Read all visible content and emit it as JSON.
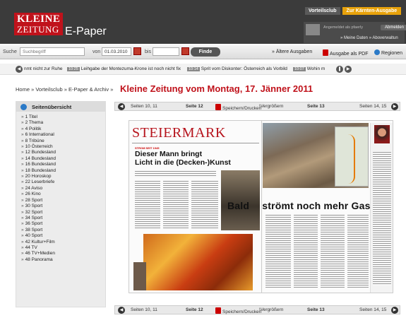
{
  "header": {
    "logo_top": "KLEINE",
    "logo_bottom": "ZEITUNG",
    "product": "E-Paper",
    "tab_club": "Vorteilsclub",
    "tab_region": "Zur Kärnten-Ausgabe",
    "login_status": "Angemeldet als pfaerly",
    "logout": "Abmelden",
    "user_links": "» Meine Daten » Aboverwaltun"
  },
  "search": {
    "label": "Suche",
    "placeholder": "Suchbegriff",
    "from_label": "von",
    "from_value": "01.03.2010",
    "to_label": "bis",
    "find": "Finde",
    "older": "» Ältere Ausgaben",
    "pdf": "Ausgabe als PDF",
    "regions": "Regionen"
  },
  "ticker": {
    "items": [
      {
        "time": "",
        "text": "nmt nicht zur Ruhe"
      },
      {
        "time": "10:25",
        "text": "Leihgabe der Montezuma-Krone ist noch nicht fix"
      },
      {
        "time": "10:14",
        "text": "Sprit vom Diskonter: Österreich als Vorbild"
      },
      {
        "time": "10:07",
        "text": "Wohin m"
      }
    ]
  },
  "breadcrumb": "Home » Vorteilsclub » E-Paper & Archiv »",
  "page_title": "Kleine Zeitung vom Montag, 17. Jänner 2011",
  "sidebar": {
    "title": "Seitenübersicht",
    "items": [
      "1 Titel",
      "2 Thema",
      "4 Politik",
      "6 International",
      "8 Tribüne",
      "10 Österreich",
      "12 Bundesland",
      "14 Bundesland",
      "16 Bundesland",
      "18 Bundesland",
      "20 Horoskop",
      "22 Leserbriefe",
      "24 Aviso",
      "26 Kino",
      "28 Sport",
      "30 Sport",
      "32 Sport",
      "34 Sport",
      "36 Sport",
      "38 Sport",
      "40 Sport",
      "42 Kultur+Film",
      "44 TV",
      "46 TV+Medien",
      "48 Panorama"
    ]
  },
  "pagenav": {
    "prev": "Seiten 10, 11",
    "left_page": "Seite 12",
    "save": "Speichern/Drucken",
    "zoom": "Vergrößern",
    "right_page": "Seite 13",
    "next": "Seiten 14, 15"
  },
  "newspaper": {
    "section": "STEIERMARK",
    "rubric": "STROM SEIT 1945",
    "headline_left_1": "Dieser Mann bringt",
    "headline_left_2": "Licht in die (Decken-)Kunst",
    "headline_right_1": "Bald",
    "headline_right_2": "strömt noch mehr Gas"
  }
}
